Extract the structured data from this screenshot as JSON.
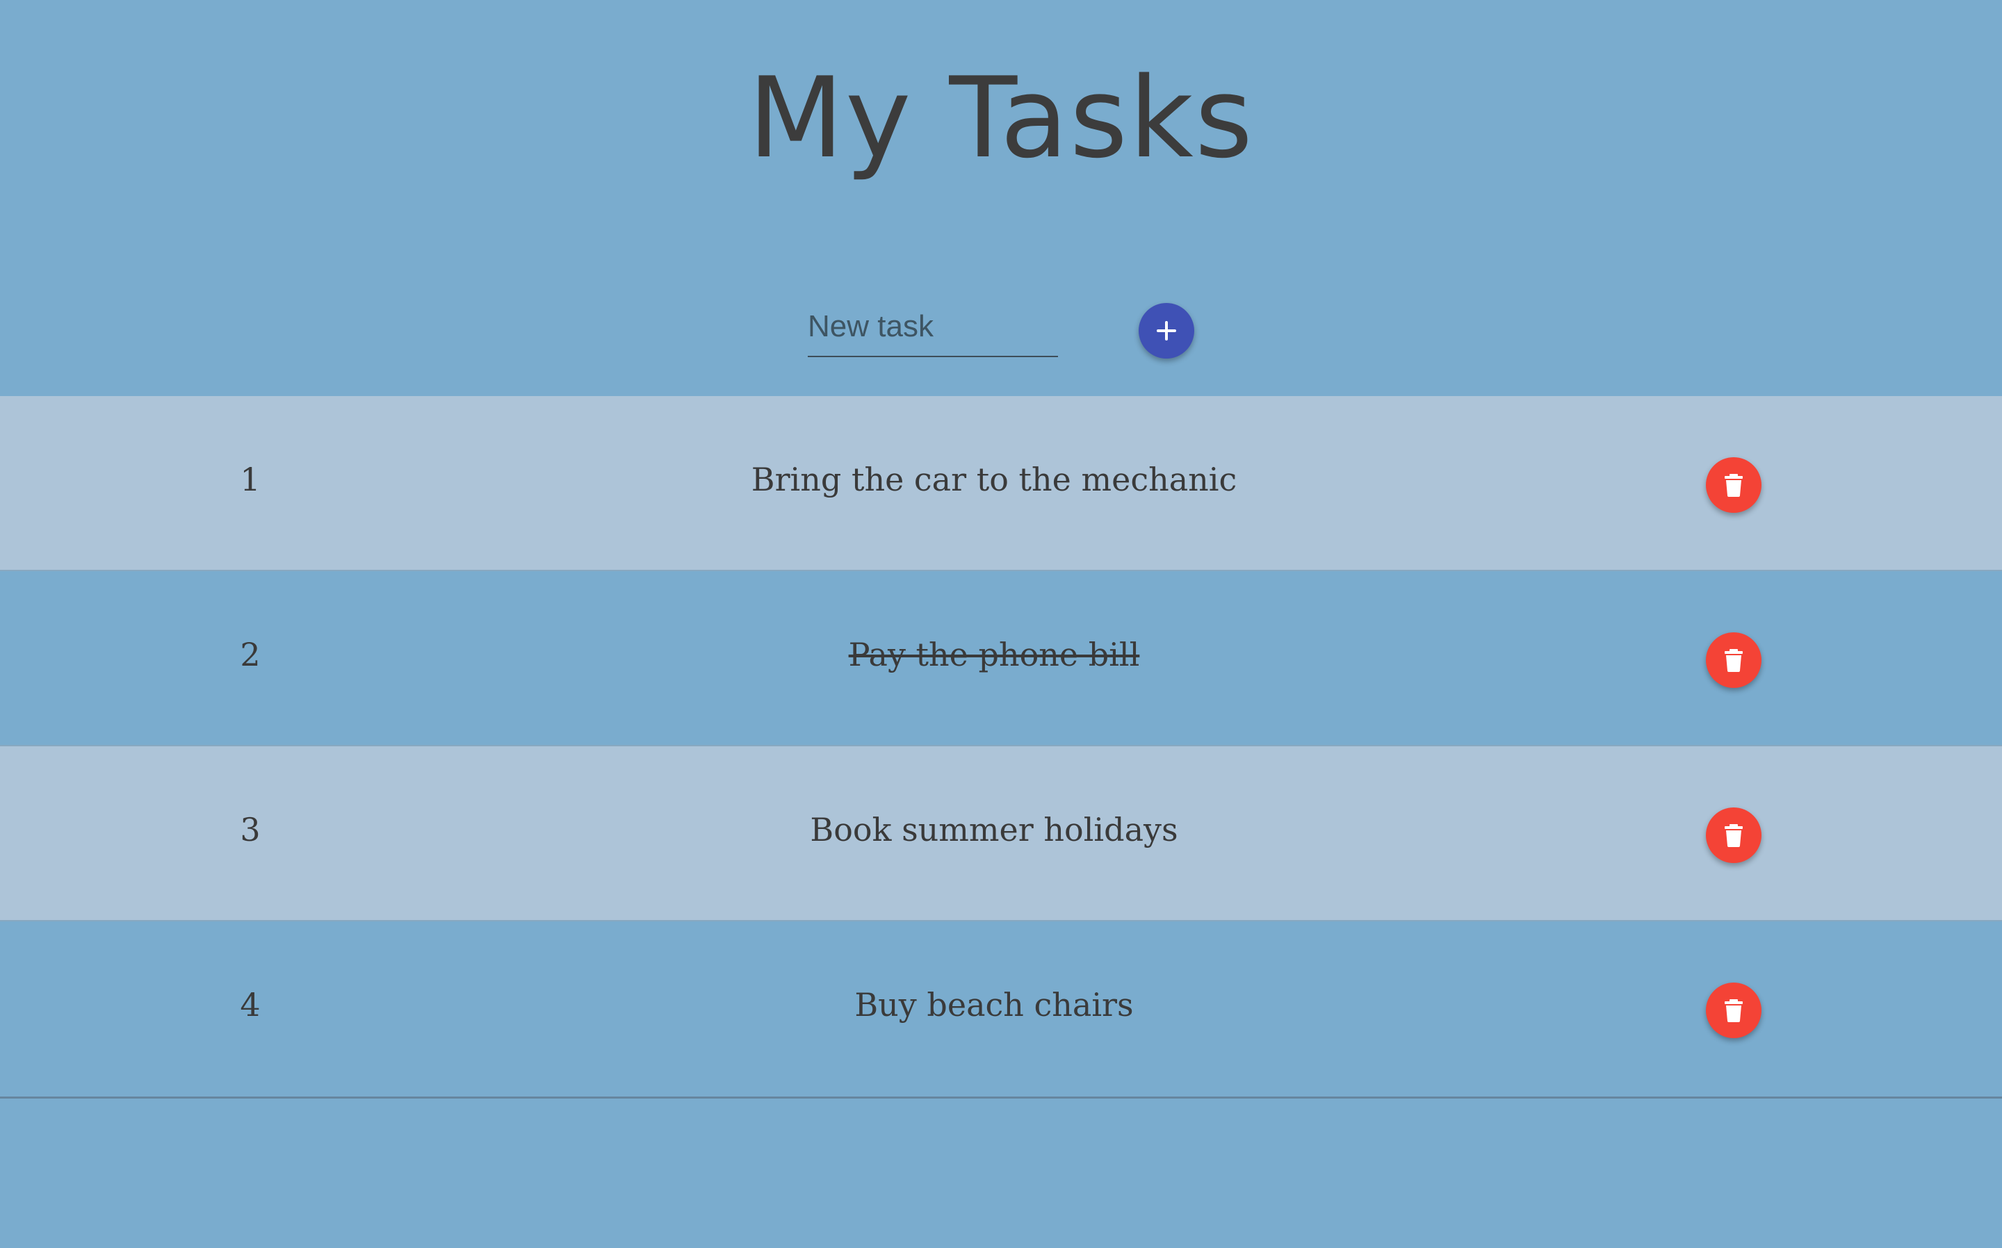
{
  "header": {
    "title": "My Tasks"
  },
  "new_task": {
    "value": "",
    "placeholder": "New task",
    "add_icon": "plus-icon",
    "add_color": "#3f51b5"
  },
  "tasks": [
    {
      "number": "1",
      "text": "Bring the car to the mechanic",
      "done": false
    },
    {
      "number": "2",
      "text": "Pay the phone bill",
      "done": true
    },
    {
      "number": "3",
      "text": "Book summer holidays",
      "done": false
    },
    {
      "number": "4",
      "text": "Buy beach chairs",
      "done": false
    }
  ],
  "delete_icon": "trash-icon",
  "colors": {
    "background": "#7aacce",
    "row_alt": "#adc4d8",
    "delete": "#f44336",
    "text": "#3a3a3a"
  }
}
